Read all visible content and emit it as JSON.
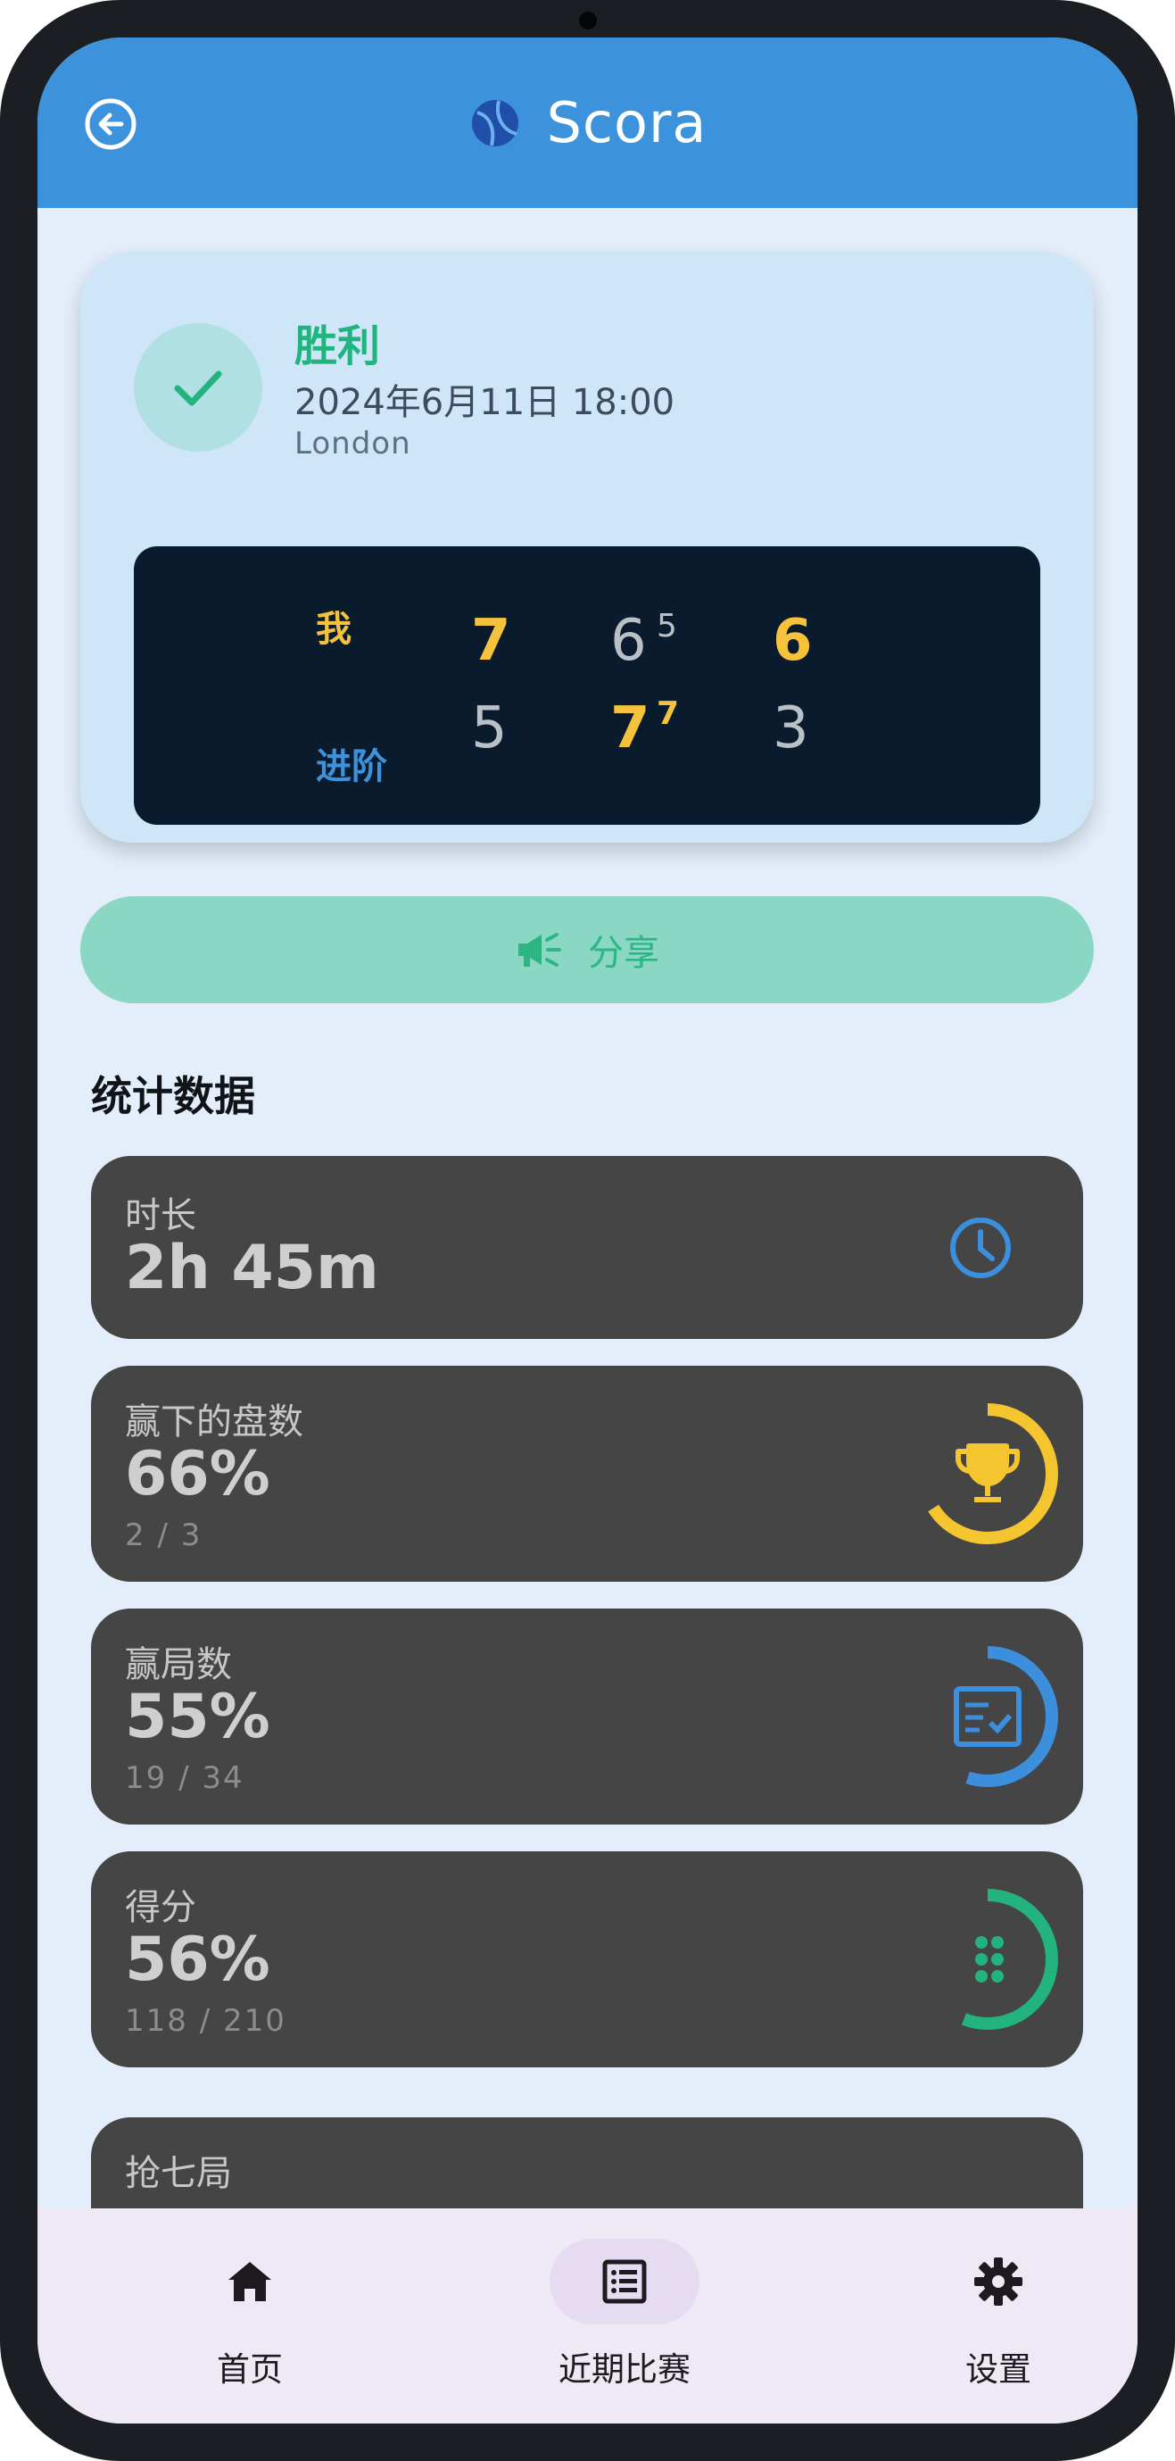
{
  "app": {
    "title": "Scora"
  },
  "match": {
    "result": "胜利",
    "datetime": "2024年6月11日 18:00",
    "venue": "London",
    "players": [
      "我",
      "进阶"
    ],
    "sets": [
      {
        "p1": "7",
        "p2": "5",
        "p1_tb": "",
        "p2_tb": ""
      },
      {
        "p1": "6",
        "p2": "7",
        "p1_tb": "5",
        "p2_tb": "7"
      },
      {
        "p1": "6",
        "p2": "3",
        "p1_tb": "",
        "p2_tb": ""
      }
    ]
  },
  "share": {
    "label": "分享"
  },
  "stats": {
    "title": "统计数据",
    "duration": {
      "label": "时长",
      "value": "2h 45m",
      "icon": "clock-icon"
    },
    "sets_won": {
      "label": "赢下的盘数",
      "value": "66%",
      "detail": "2 / 3",
      "fraction": 0.66,
      "color": "#f5c52f",
      "icon": "trophy-icon"
    },
    "games_won": {
      "label": "赢局数",
      "value": "55%",
      "detail": "19 / 34",
      "fraction": 0.55,
      "color": "#3b8fdc",
      "icon": "scorecard-icon"
    },
    "points": {
      "label": "得分",
      "value": "56%",
      "detail": "118 / 210",
      "fraction": 0.56,
      "color": "#22b37e",
      "icon": "dots-icon"
    },
    "tiebreaks": {
      "label": "抢七局"
    }
  },
  "nav": [
    {
      "label": "首页",
      "icon": "home-icon",
      "active": false
    },
    {
      "label": "近期比赛",
      "icon": "list-icon",
      "active": true
    },
    {
      "label": "设置",
      "icon": "gear-icon",
      "active": false
    }
  ],
  "colors": {
    "appbar": "#3d92dc",
    "win": "#f5c33b",
    "p2_name": "#3d92dc",
    "success": "#22b37e"
  }
}
